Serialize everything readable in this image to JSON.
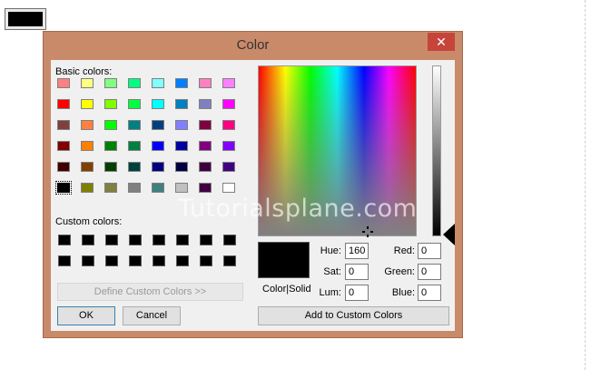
{
  "dialog": {
    "title": "Color",
    "close_glyph": "✕"
  },
  "labels": {
    "basic_colors": "Basic colors:",
    "custom_colors": "Custom colors:",
    "color_solid": "Color|Solid",
    "hue": "Hue:",
    "sat": "Sat:",
    "lum": "Lum:",
    "red": "Red:",
    "green": "Green:",
    "blue": "Blue:"
  },
  "buttons": {
    "define_custom": "Define Custom Colors >>",
    "ok": "OK",
    "cancel": "Cancel",
    "add_custom": "Add to Custom Colors"
  },
  "values": {
    "hue": "160",
    "sat": "0",
    "lum": "0",
    "red": "0",
    "green": "0",
    "blue": "0"
  },
  "watermark": "Tutorialsplane.com",
  "colors": {
    "dialog_border": "#c98a6a",
    "close_button": "#c7443b",
    "current_color": "#000000"
  },
  "basic_colors": [
    [
      "#ff8080",
      "#ffff80",
      "#80ff80",
      "#00ff80",
      "#80ffff",
      "#0080ff",
      "#ff80c0",
      "#ff80ff"
    ],
    [
      "#ff0000",
      "#ffff00",
      "#80ff00",
      "#00ff40",
      "#00ffff",
      "#0080c0",
      "#8080c0",
      "#ff00ff"
    ],
    [
      "#804040",
      "#ff8040",
      "#00ff00",
      "#008080",
      "#004080",
      "#8080ff",
      "#800040",
      "#ff0080"
    ],
    [
      "#800000",
      "#ff8000",
      "#008000",
      "#008040",
      "#0000ff",
      "#0000a0",
      "#800080",
      "#8000ff"
    ],
    [
      "#400000",
      "#804000",
      "#004000",
      "#004040",
      "#000080",
      "#000040",
      "#400040",
      "#400080"
    ],
    [
      "#000000",
      "#808000",
      "#808040",
      "#808080",
      "#408080",
      "#c0c0c0",
      "#400040",
      "#ffffff"
    ]
  ],
  "selected_basic": {
    "row": 5,
    "col": 0
  },
  "custom_colors": [
    [
      "#000000",
      "#000000",
      "#000000",
      "#000000",
      "#000000",
      "#000000",
      "#000000",
      "#000000"
    ],
    [
      "#000000",
      "#000000",
      "#000000",
      "#000000",
      "#000000",
      "#000000",
      "#000000",
      "#000000"
    ]
  ],
  "icons": {
    "close": "close-icon",
    "crosshair": "crosshair-icon",
    "luminance_arrow": "luminance-arrow-icon"
  }
}
